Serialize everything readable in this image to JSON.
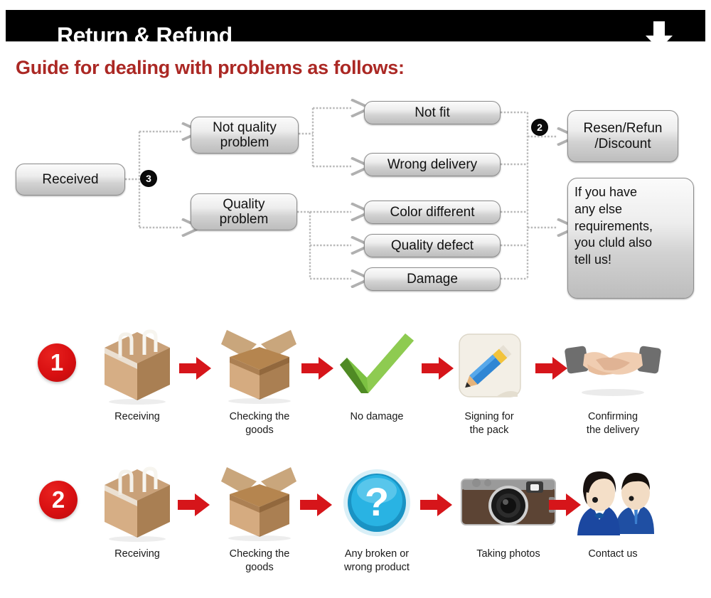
{
  "header": {
    "title": "Return & Refund",
    "arrow_icon": "down-arrow-icon",
    "bar_color": "#000000",
    "title_color": "#ffffff"
  },
  "guide": {
    "heading": "Guide for dealing with problems as follows:",
    "heading_color": "#ab2824"
  },
  "flowchart": {
    "start": {
      "label": "Received"
    },
    "branch_badge": "3",
    "categories": [
      {
        "label": "Not quality\nproblem"
      },
      {
        "label": "Quality\nproblem"
      }
    ],
    "issues": [
      {
        "label": "Not fit"
      },
      {
        "label": "Wrong delivery"
      },
      {
        "label": "Color different"
      },
      {
        "label": "Quality defect"
      },
      {
        "label": "Damage"
      }
    ],
    "outcome_badge": "2",
    "outcomes": [
      {
        "label": "Resen/Refun\n/Discount"
      },
      {
        "label": "If you have\nany else\nrequirements,\nyou cluld also\ntell us!"
      }
    ]
  },
  "process_rows": [
    {
      "number": "1",
      "steps": [
        {
          "label": "Receiving",
          "icon": "closed-box-icon"
        },
        {
          "label": "Checking the\ngoods",
          "icon": "open-box-icon"
        },
        {
          "label": "No damage",
          "icon": "green-check-icon"
        },
        {
          "label": "Signing for\nthe pack",
          "icon": "pencil-icon"
        },
        {
          "label": "Confirming\nthe delivery",
          "icon": "handshake-icon"
        }
      ]
    },
    {
      "number": "2",
      "steps": [
        {
          "label": "Receiving",
          "icon": "closed-box-icon"
        },
        {
          "label": "Checking the\ngoods",
          "icon": "open-box-icon"
        },
        {
          "label": "Any broken or\nwrong product",
          "icon": "question-mark-icon"
        },
        {
          "label": "Taking photos",
          "icon": "camera-icon"
        },
        {
          "label": "Contact us",
          "icon": "support-agents-icon"
        }
      ]
    }
  ],
  "colors": {
    "accent_red": "#d80f11",
    "heading_red": "#ab2824",
    "box_border": "#8d8d8d",
    "connector": "#b4b4b4"
  }
}
